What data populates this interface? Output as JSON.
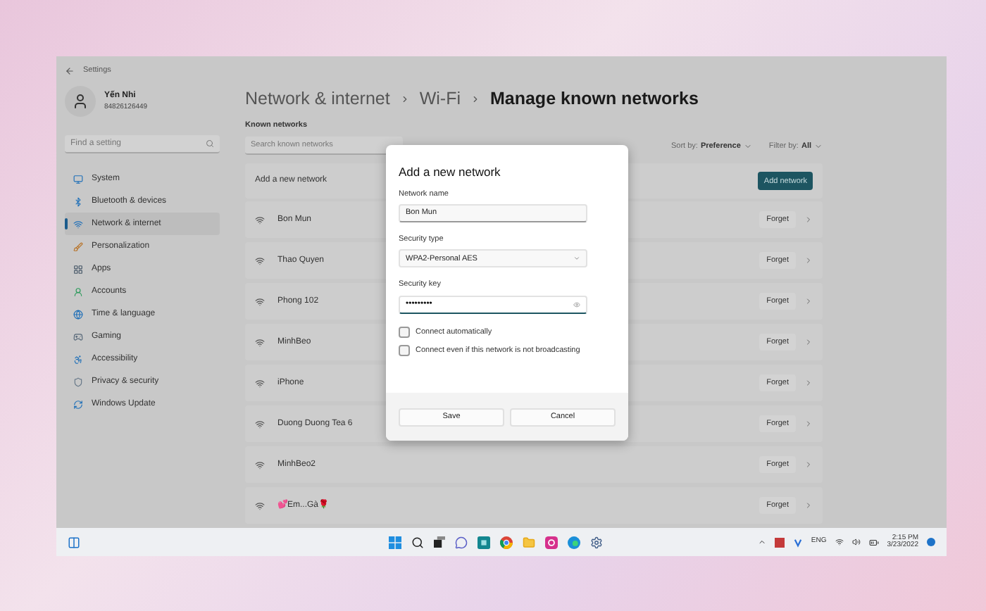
{
  "window": {
    "title": "Settings"
  },
  "user": {
    "name": "Yến Nhi",
    "id": "84826126449"
  },
  "sidebar": {
    "search": {
      "placeholder": "Find a setting"
    },
    "items": [
      {
        "label": "System",
        "selected": false
      },
      {
        "label": "Bluetooth & devices",
        "selected": false
      },
      {
        "label": "Network & internet",
        "selected": true
      },
      {
        "label": "Personalization",
        "selected": false
      },
      {
        "label": "Apps",
        "selected": false
      },
      {
        "label": "Accounts",
        "selected": false
      },
      {
        "label": "Time & language",
        "selected": false
      },
      {
        "label": "Gaming",
        "selected": false
      },
      {
        "label": "Accessibility",
        "selected": false
      },
      {
        "label": "Privacy & security",
        "selected": false
      },
      {
        "label": "Windows Update",
        "selected": false
      }
    ]
  },
  "breadcrumb": [
    "Network & internet",
    "Wi-Fi",
    "Manage known networks"
  ],
  "known_networks": {
    "heading": "Known networks",
    "search": {
      "placeholder": "Search known networks"
    },
    "sort_label": "Sort by:",
    "sort_value": "Preference",
    "filter_label": "Filter by:",
    "filter_value": "All",
    "add_label": "Add a new network",
    "add_button": "Add network",
    "networks": [
      {
        "name": "Bon Mun",
        "action": "Forget"
      },
      {
        "name": "Thao Quyen",
        "action": "Forget"
      },
      {
        "name": "Phong 102",
        "action": "Forget"
      },
      {
        "name": "MinhBeo",
        "action": "Forget"
      },
      {
        "name": "iPhone",
        "action": "Forget"
      },
      {
        "name": "Duong Duong Tea 6",
        "action": "Forget"
      },
      {
        "name": "MinhBeo2",
        "action": "Forget"
      },
      {
        "name": "💕Em...Gà🌹",
        "action": "Forget"
      }
    ]
  },
  "dialog": {
    "title": "Add a new network",
    "fields": [
      {
        "kind": "text",
        "label": "Network name",
        "value": "Bon Mun"
      },
      {
        "kind": "select",
        "label": "Security type",
        "value": "WPA2-Personal AES"
      },
      {
        "kind": "password",
        "label": "Security key",
        "value": "•••••••••"
      }
    ],
    "checkboxes": [
      {
        "label": "Connect automatically",
        "checked": false
      },
      {
        "label": "Connect even if this network is not broadcasting",
        "checked": false
      }
    ],
    "buttons": [
      "Save",
      "Cancel"
    ]
  },
  "taskbar": {
    "language": "ENG",
    "time": "2:15 PM",
    "date": "3/23/2022"
  }
}
